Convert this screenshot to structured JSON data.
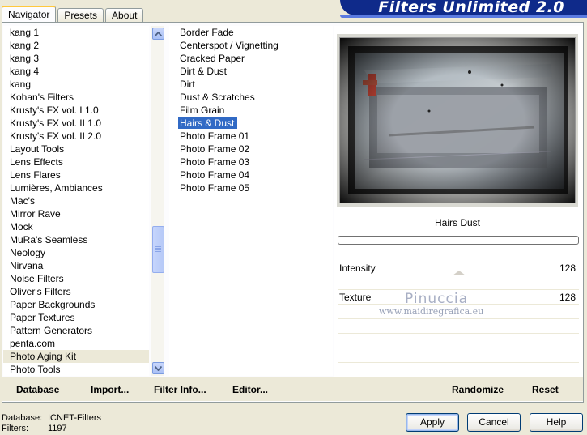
{
  "tabs": [
    "Navigator",
    "Presets",
    "About"
  ],
  "banner_title": "Filters Unlimited 2.0",
  "categories": [
    "kang 1",
    "kang 2",
    "kang 3",
    "kang 4",
    "kang",
    "Kohan's Filters",
    "Krusty's FX vol. I 1.0",
    "Krusty's FX vol. II 1.0",
    "Krusty's FX vol. II 2.0",
    "Layout Tools",
    "Lens Effects",
    "Lens Flares",
    "Lumières, Ambiances",
    "Mac's",
    "Mirror Rave",
    "Mock",
    "MuRa's Seamless",
    "Neology",
    "Nirvana",
    "Noise Filters",
    "Oliver's Filters",
    "Paper Backgrounds",
    "Paper Textures",
    "Pattern Generators",
    "penta.com",
    "Photo Aging Kit",
    "Photo Tools"
  ],
  "selected_category": "Photo Aging Kit",
  "filters": [
    "Border Fade",
    "Centerspot / Vignetting",
    "Cracked Paper",
    "Dirt & Dust",
    "Dirt",
    "Dust & Scratches",
    "Film Grain",
    "Hairs & Dust",
    "Photo Frame 01",
    "Photo Frame 02",
    "Photo Frame 03",
    "Photo Frame 04",
    "Photo Frame 05"
  ],
  "selected_filter": "Hairs & Dust",
  "effect_name": "Hairs  Dust",
  "params": {
    "intensity": {
      "label": "Intensity",
      "value": "128"
    },
    "texture": {
      "label": "Texture",
      "value": "128"
    }
  },
  "watermark": {
    "name": "Pinuccia",
    "url": "www.maidiregrafica.eu"
  },
  "toolbar": {
    "database": "Database",
    "import": "Import...",
    "filter_info": "Filter Info...",
    "editor": "Editor...",
    "randomize": "Randomize",
    "reset": "Reset"
  },
  "status": {
    "database_label": "Database:",
    "database_value": "ICNET-Filters",
    "filters_label": "Filters:",
    "filters_value": "1197"
  },
  "buttons": {
    "apply": "Apply",
    "cancel": "Cancel",
    "help": "Help"
  }
}
